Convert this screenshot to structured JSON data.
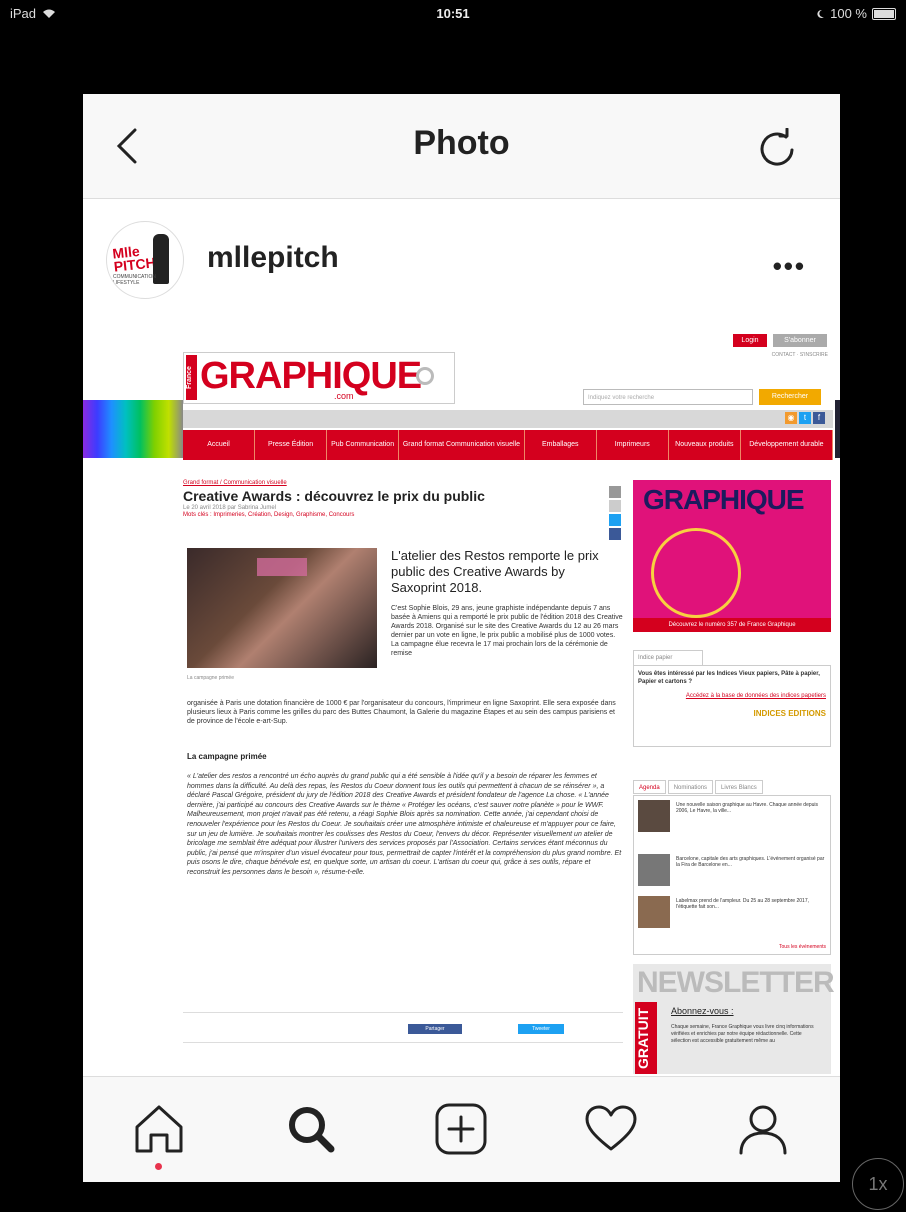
{
  "status_bar": {
    "device": "iPad",
    "time": "10:51",
    "battery": "100 %"
  },
  "nav": {
    "title": "Photo"
  },
  "post": {
    "username": "mllepitch",
    "avatar_text": "Mlle PITCH",
    "avatar_sub": "COMMUNICATION LIFESTYLE"
  },
  "site": {
    "login_label": "Login",
    "subscribe_label": "S'abonner",
    "top_links": "CONTACT · S'INSCRIRE",
    "logo_side": "France",
    "logo": "GRAPHIQUE",
    "logo_com": ".com",
    "search_placeholder": "Indiquez votre recherche",
    "search_button": "Rechercher",
    "menu": [
      "Accueil",
      "Presse Édition",
      "Pub Communication",
      "Grand format Communication visuelle",
      "Emballages",
      "Imprimeurs",
      "Nouveaux produits",
      "Développement durable"
    ],
    "article": {
      "breadcrumb": "Grand format / Communication visuelle",
      "title": "Creative Awards : découvrez le prix du public",
      "meta": "Le 20 avril 2018 par Sabrina Jumel",
      "tags": "Mots clés : Imprimeries, Création, Design, Graphisme, Concours",
      "lead": "L'atelier des Restos remporte le prix public des Creative Awards by Saxoprint 2018.",
      "body1": "C'est Sophie Blois, 29 ans, jeune graphiste indépendante depuis 7 ans basée à Amiens qui a remporté le prix public de l'édition 2018 des Creative Awards 2018. Organisé sur le site des Creative Awards du 12 au 26 mars dernier par un vote en ligne, le prix public a mobilisé plus de 1000 votes. La campagne élue recevra le 17 mai prochain lors de la cérémonie de remise",
      "body2": "organisée à Paris une dotation financière de 1000 € par l'organisateur du concours, l'imprimeur en ligne Saxoprint. Elle sera exposée dans plusieurs lieux à Paris comme les grilles du parc des Buttes Chaumont, la Galerie du magazine Étapes et au sein des campus parisiens et de province de l'école e-art-Sup.",
      "img_caption": "La campagne primée",
      "subheading": "La campagne primée",
      "quote": "« L'atelier des restos a rencontré un écho auprès du grand public qui a été sensible à l'idée qu'il y a besoin de réparer les femmes et hommes dans la difficulté. Au delà des repas, les Restos du Coeur donnent tous les outils qui permettent à chacun de se réinsérer », a déclaré Pascal Grégoire, président du jury de l'édition 2018 des Creative Awards et président fondateur de l'agence La chose. « L'année dernière, j'ai participé au concours des Creative Awards sur le thème « Protéger les océans, c'est sauver notre planète » pour le WWF. Malheureusement, mon projet n'avait pas été retenu, a réagi Sophie Blois après sa nomination. Cette année, j'ai cependant choisi de renouveler l'expérience pour les Restos du Coeur. Je souhaitais créer une atmosphère intimiste et chaleureuse et m'appuyer pour ce faire, sur un jeu de lumière. Je souhaitais montrer les coulisses des Restos du Coeur, l'envers du décor. Représenter visuellement un atelier de bricolage me semblait être adéquat pour illustrer l'univers des services proposés par l'Association. Certains services étant méconnus du public, j'ai pensé que m'inspirer d'un visuel évocateur pour tous, permettrait de capter l'intérêt et la compréhension du plus grand nombre. Et puis osons le dire, chaque bénévole est, en quelque sorte, un artisan du coeur. L'artisan du coeur qui, grâce à ses outils, répare et reconstruit les personnes dans le besoin », résume-t-elle.",
      "share_fb": "Partager",
      "share_tw": "Tweeter"
    },
    "sidebar": {
      "promo_logo": "GRAPHIQUE",
      "promo_caption": "Découvrez le numéro 357 de France Graphique",
      "indices_tab": "Indice papier",
      "indices_text": "Vous êtes intéressé par les Indices Vieux papiers, Pâte à papier, Papier et cartons ?",
      "indices_link": "Accédez à la base de données des indices papetiers",
      "indices_logo": "INDICES EDITIONS",
      "tabs": [
        "Agenda",
        "Nominations",
        "Livres Blancs"
      ],
      "news": [
        "Une nouvelle saison graphique au Havre. Chaque année depuis 2006, Le Havre, la ville...",
        "Barcelone, capitale des arts graphiques. L'événement organisé par la Fira de Barcelone en...",
        "Labelmax prend de l'ampleur. Du 25 au 28 septembre 2017, l'étiquette fait son..."
      ],
      "news_more": "Tous les événements",
      "newsletter_title": "NEWSLETTER",
      "newsletter_vertical": "GRATUIT",
      "newsletter_sub": "Abonnez-vous :",
      "newsletter_text": "Chaque semaine, France Graphique vous livre cinq informations vérifiées et enrichies par notre équipe rédactionnelle. Cette sélection est accessible gratuitement même au"
    }
  },
  "tabbar": {
    "items": [
      "home",
      "search",
      "new-post",
      "activity",
      "profile"
    ],
    "active": "home"
  },
  "zoom_badge": "1x"
}
